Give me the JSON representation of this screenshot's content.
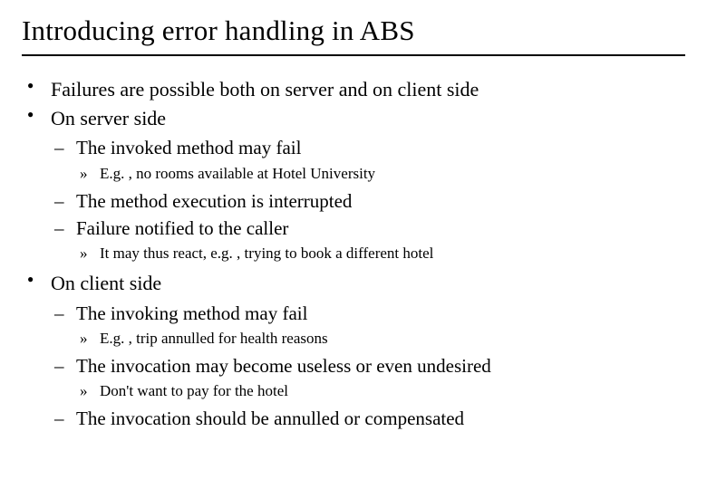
{
  "title": "Introducing error handling in ABS",
  "bullets": {
    "b1": "Failures are possible both on server and on client side",
    "b2": "On server side",
    "b2_1": "The invoked method may fail",
    "b2_1_1": "E.g. , no rooms available at Hotel University",
    "b2_2": "The method execution is interrupted",
    "b2_3": "Failure notified to the caller",
    "b2_3_1": "It may thus react, e.g. , trying to book a different hotel",
    "b3": "On client side",
    "b3_1": "The invoking method may fail",
    "b3_1_1": "E.g. , trip annulled for health reasons",
    "b3_2": "The invocation may become useless or even undesired",
    "b3_2_1": "Don't want to pay for the hotel",
    "b3_3": "The invocation should be annulled or compensated"
  }
}
